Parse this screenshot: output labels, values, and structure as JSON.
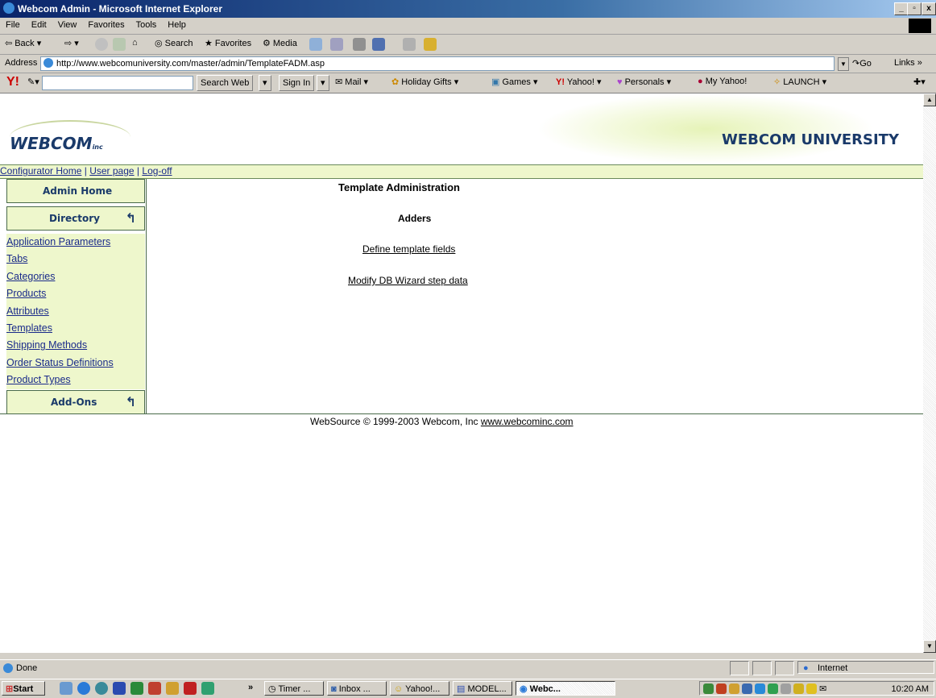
{
  "window": {
    "title": "Webcom Admin - Microsoft Internet Explorer"
  },
  "menu": [
    "File",
    "Edit",
    "View",
    "Favorites",
    "Tools",
    "Help"
  ],
  "toolbar": {
    "back": "Back",
    "search": "Search",
    "favorites": "Favorites",
    "media": "Media"
  },
  "address": {
    "label": "Address",
    "url": "http://www.webcomuniversity.com/master/admin/TemplateFADM.asp",
    "go": "Go",
    "links": "Links"
  },
  "yahoo": {
    "search_web": "Search Web",
    "sign_in": "Sign In",
    "items": [
      "Mail",
      "Holiday Gifts",
      "Games",
      "Yahoo!",
      "Personals",
      "My Yahoo!",
      "LAUNCH"
    ]
  },
  "header": {
    "logo": "WEBCOM",
    "logo_sub": "inc",
    "brand": "WEBCOM UNIVERSITY"
  },
  "topnav": {
    "home": "Configurator Home",
    "user": "User page",
    "logoff": "Log-off",
    "sep": "|"
  },
  "sidebar": {
    "admin_home": "Admin Home",
    "directory": "Directory",
    "items": [
      "Application Parameters",
      "Tabs",
      "Categories",
      "Products",
      "Attributes",
      "Templates",
      "Shipping Methods",
      "Order Status Definitions",
      "Product Types"
    ],
    "addons": "Add-Ons"
  },
  "main": {
    "title": "Template Administration",
    "subtitle": "Adders",
    "link1": "Define template fields",
    "link2": "Modify DB Wizard step data"
  },
  "footer": {
    "text": "WebSource © 1999-2003 Webcom, Inc ",
    "link": "www.webcominc.com"
  },
  "status": {
    "text": "Done",
    "zone": "Internet"
  },
  "taskbar": {
    "start": "Start",
    "tasks": [
      "Timer ...",
      "Inbox ...",
      "Yahoo!...",
      "MODEL...",
      "Webc..."
    ],
    "clock": "10:20 AM"
  }
}
